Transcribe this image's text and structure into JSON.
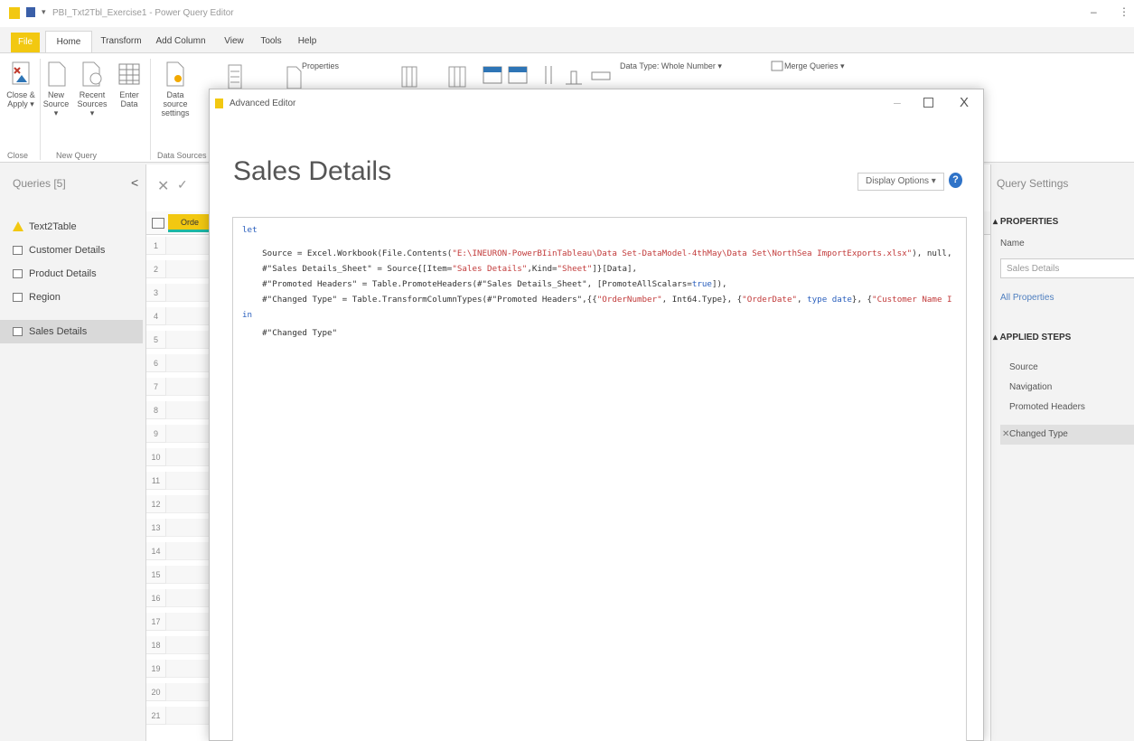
{
  "window": {
    "title": "PBI_Txt2Tbl_Exercise1 - Power Query Editor",
    "minimize_glyph": "–",
    "caret_glyph": "▾"
  },
  "tabs": [
    "File",
    "Home",
    "Transform",
    "Add Column",
    "View",
    "Tools",
    "Help"
  ],
  "ribbon": {
    "close_apply": "Close & Apply ▾",
    "new_source": "New Source ▾",
    "recent_sources": "Recent Sources ▾",
    "enter_data": "Enter Data",
    "data_source_settings": "Data source settings",
    "properties": "Properties",
    "data_type": "Data Type: Whole Number ▾",
    "merge_queries": "Merge Queries ▾",
    "groups": {
      "close": "Close",
      "new_query": "New Query",
      "data_sources": "Data Sources"
    }
  },
  "queries": {
    "header": "Queries [5]",
    "collapse_glyph": "<",
    "items": [
      {
        "label": "Text2Table",
        "icon": "warning-icon"
      },
      {
        "label": "Customer Details",
        "icon": "table-icon"
      },
      {
        "label": "Product Details",
        "icon": "table-icon"
      },
      {
        "label": "Region",
        "icon": "table-icon"
      },
      {
        "label": "Sales Details",
        "icon": "table-icon",
        "selected": true
      }
    ]
  },
  "grid": {
    "formula_cancel": "✕",
    "formula_confirm": "✓",
    "column_header": "Orde",
    "rows": [
      "1",
      "2",
      "3",
      "4",
      "5",
      "6",
      "7",
      "8",
      "9",
      "10",
      "11",
      "12",
      "13",
      "14",
      "15",
      "16",
      "17",
      "18",
      "19",
      "20",
      "21"
    ]
  },
  "settings": {
    "header": "Query Settings",
    "properties_label": "PROPERTIES",
    "name_label": "Name",
    "name_value": "Sales Details",
    "all_properties": "All Properties",
    "applied_steps_label": "APPLIED STEPS",
    "steps": [
      "Source",
      "Navigation",
      "Promoted Headers",
      "Changed Type"
    ],
    "delete_glyph": "✕"
  },
  "dialog": {
    "title": "Advanced Editor",
    "minimize_glyph": "–",
    "close_glyph": "X",
    "query_name": "Sales Details",
    "display_options": "Display Options ▾",
    "help_glyph": "?",
    "code": {
      "l1": "let",
      "l2a": "    Source = Excel.Workbook(File.Contents(",
      "l2b": "\"E:\\INEURON-PowerBIinTableau\\Data Set-DataModel-4thMay\\Data Set\\NorthSea ImportExports.xlsx\"",
      "l2c": "), null,",
      "l3a": "    #\"Sales Details_Sheet\" = Source{[Item=",
      "l3b": "\"Sales Details\"",
      "l3c": ",Kind=",
      "l3d": "\"Sheet\"",
      "l3e": "]}[Data],",
      "l4a": "    #\"Promoted Headers\" = Table.PromoteHeaders(#\"Sales Details_Sheet\", [PromoteAllScalars=",
      "l4b": "true",
      "l4c": "]),",
      "l5a": "    #\"Changed Type\" = Table.TransformColumnTypes(#\"Promoted Headers\",{{",
      "l5b": "\"OrderNumber\"",
      "l5c": ", Int64.Type}, {",
      "l5d": "\"OrderDate\"",
      "l5e": ", ",
      "l5f": "type date",
      "l5g": "}, {",
      "l5h": "\"Customer Name I",
      "l6": "in",
      "l7": "    #\"Changed Type\""
    }
  }
}
